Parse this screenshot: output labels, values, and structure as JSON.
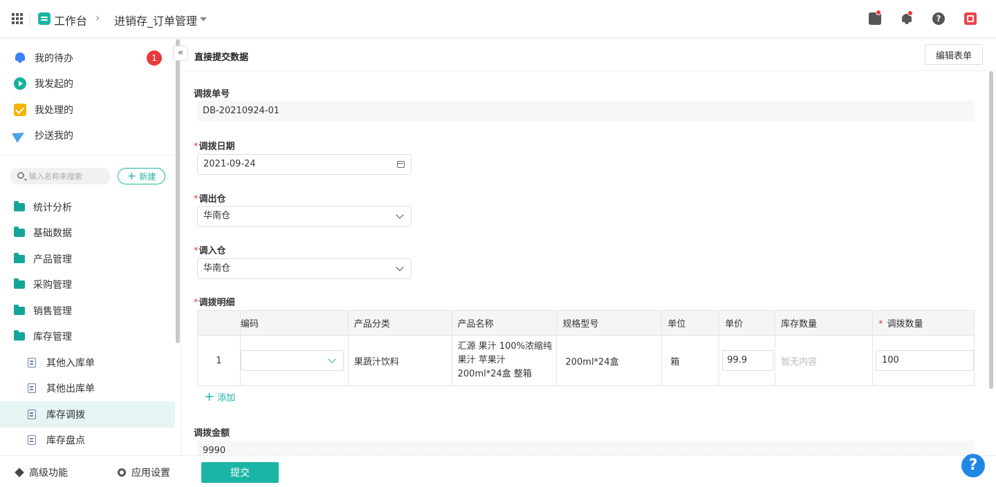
{
  "header": {
    "workspace": "工作台",
    "app_name": "进销存_订单管理"
  },
  "sidebar": {
    "top_items": [
      {
        "label": "我的待办",
        "badge": "1"
      },
      {
        "label": "我发起的"
      },
      {
        "label": "我处理的"
      },
      {
        "label": "抄送我的"
      }
    ],
    "search_placeholder": "输入名称来搜索",
    "new_label": "新建",
    "folders": [
      "统计分析",
      "基础数据",
      "产品管理",
      "采购管理",
      "销售管理",
      "库存管理"
    ],
    "sub_items": [
      "其他入库单",
      "其他出库单",
      "库存调拨",
      "库存盘点"
    ],
    "active_sub": "库存调拨",
    "footer": {
      "advanced": "高级功能",
      "settings": "应用设置"
    }
  },
  "form": {
    "title": "直接提交数据",
    "edit_label": "编辑表单",
    "fields": {
      "transfer_no": {
        "label": "调拨单号",
        "value": "DB-20210924-01"
      },
      "transfer_date": {
        "label": "调拨日期",
        "value": "2021-09-24"
      },
      "out_warehouse": {
        "label": "调出仓",
        "value": "华南仓"
      },
      "in_warehouse": {
        "label": "调入仓",
        "value": "华南仓"
      },
      "details": {
        "label": "调拨明细"
      },
      "amount": {
        "label": "调拨金额",
        "value": "9990"
      }
    },
    "table": {
      "columns": [
        "编码",
        "产品分类",
        "产品名称",
        "规格型号",
        "单位",
        "单价",
        "库存数量",
        "调拨数量"
      ],
      "rows": [
        {
          "index": "1",
          "code": "",
          "category": "果蔬汁饮料",
          "name": "汇源 果汁 100%浓缩纯果汁 苹果汁 200ml*24盒 整箱",
          "spec": "200ml*24盒",
          "unit": "箱",
          "price": "99.9",
          "stock": "暂无内容",
          "qty": "100"
        }
      ]
    },
    "add_label": "添加",
    "submit_label": "提交"
  },
  "colors": {
    "accent": "#1bb5a5",
    "required": "#e83a3a",
    "help": "#1f88e5"
  }
}
